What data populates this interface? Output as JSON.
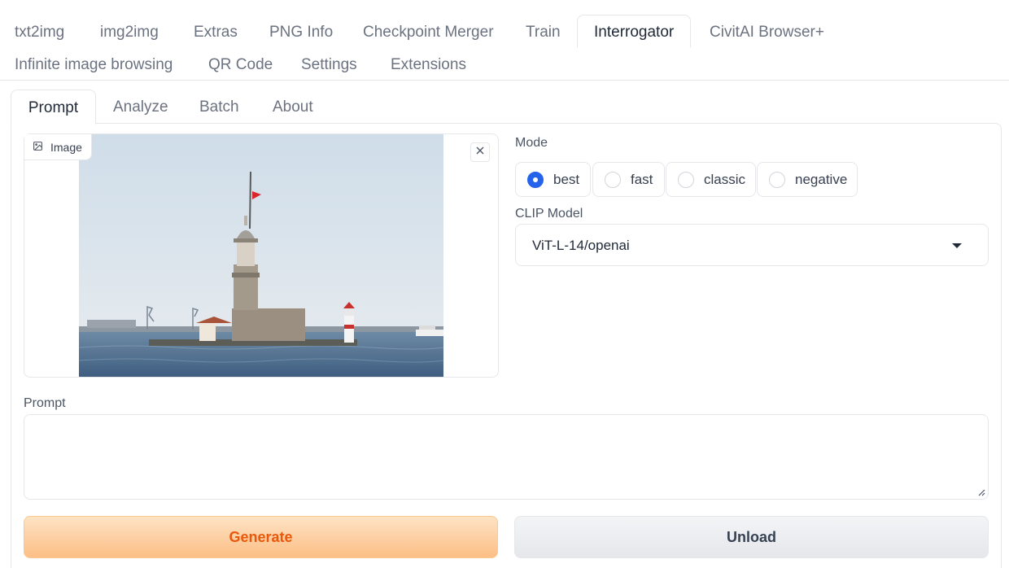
{
  "top_tabs": {
    "row1": [
      "txt2img",
      "img2img",
      "Extras",
      "PNG Info",
      "Checkpoint Merger",
      "Train",
      "Interrogator",
      "CivitAI Browser+"
    ],
    "row2": [
      "Infinite image browsing",
      "QR Code",
      "Settings",
      "Extensions"
    ],
    "active": "Interrogator"
  },
  "sub_tabs": {
    "items": [
      "Prompt",
      "Analyze",
      "Batch",
      "About"
    ],
    "active": "Prompt"
  },
  "image_block": {
    "label": "Image",
    "label_icon": "image-icon",
    "close_icon": "close-icon"
  },
  "mode": {
    "label": "Mode",
    "options": [
      "best",
      "fast",
      "classic",
      "negative"
    ],
    "selected": "best",
    "accent_color": "#2563eb"
  },
  "clip_model": {
    "label": "CLIP Model",
    "value": "ViT-L-14/openai",
    "icon": "chevron-down-icon"
  },
  "prompt": {
    "label": "Prompt",
    "value": "",
    "placeholder": ""
  },
  "buttons": {
    "generate": {
      "label": "Generate",
      "color": "#ea580c"
    },
    "unload": {
      "label": "Unload"
    }
  }
}
